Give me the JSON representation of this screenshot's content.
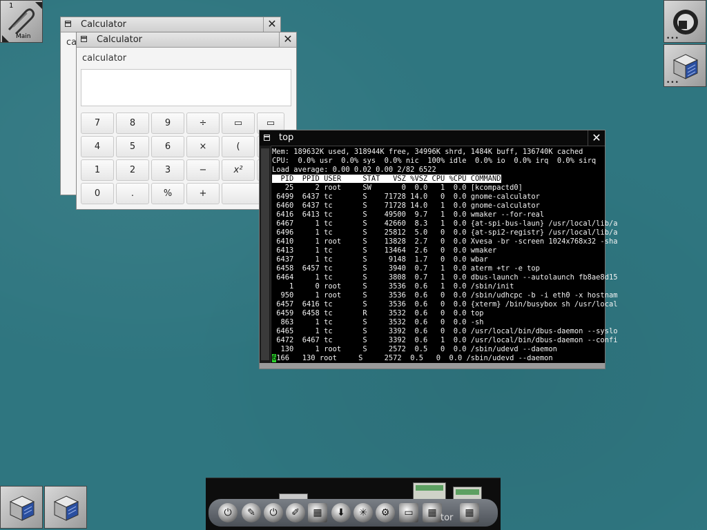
{
  "dock": {
    "clip_number": "1",
    "clip_label": "Main",
    "right_tiles": [
      "wmaker-logo-icon",
      "cube-icon"
    ],
    "bottom_tiles": [
      "cube-icon",
      "cube-icon"
    ]
  },
  "calc_back": {
    "title": "Calculator",
    "label_partial": "ca"
  },
  "calc_front": {
    "title": "Calculator",
    "label": "calculator",
    "buttons": [
      [
        "7",
        "8",
        "9",
        "÷",
        "▭",
        "▭"
      ],
      [
        "4",
        "5",
        "6",
        "×",
        "(",
        ""
      ],
      [
        "1",
        "2",
        "3",
        "−",
        "x²",
        ""
      ],
      [
        "0",
        ".",
        "%",
        "+",
        "",
        "="
      ]
    ]
  },
  "terminal": {
    "title": "top",
    "lines": [
      "Mem: 189632K used, 318944K free, 34996K shrd, 1484K buff, 136740K cached",
      "CPU:  0.0% usr  0.0% sys  0.0% nic  100% idle  0.0% io  0.0% irq  0.0% sirq",
      "Load average: 0.00 0.02 0.00 2/82 6522"
    ],
    "header": "  PID  PPID USER     STAT   VSZ %VSZ CPU %CPU COMMAND",
    "rows": [
      "   25     2 root     SW       0  0.0   1  0.0 [kcompactd0]",
      " 6499  6437 tc       S    71728 14.0   0  0.0 gnome-calculator",
      " 6460  6437 tc       S    71728 14.0   1  0.0 gnome-calculator",
      " 6416  6413 tc       S    49500  9.7   1  0.0 wmaker --for-real",
      " 6467     1 tc       S    42660  8.3   1  0.0 {at-spi-bus-laun} /usr/local/lib/a",
      " 6496     1 tc       S    25812  5.0   0  0.0 {at-spi2-registr} /usr/local/lib/a",
      " 6410     1 root     S    13828  2.7   0  0.0 Xvesa -br -screen 1024x768x32 -sha",
      " 6413     1 tc       S    13464  2.6   0  0.0 wmaker",
      " 6437     1 tc       S     9148  1.7   0  0.0 wbar",
      " 6458  6457 tc       S     3940  0.7   1  0.0 aterm +tr -e top",
      " 6464     1 tc       S     3808  0.7   1  0.0 dbus-launch --autolaunch fb8ae8d15",
      "    1     0 root     S     3536  0.6   1  0.0 /sbin/init",
      "  950     1 root     S     3536  0.6   0  0.0 /sbin/udhcpc -b -i eth0 -x hostnam",
      " 6457  6416 tc       S     3536  0.6   0  0.0 {xterm} /bin/busybox sh /usr/local",
      " 6459  6458 tc       R     3532  0.6   0  0.0 top",
      "  863     1 tc       S     3532  0.6   0  0.0 -sh",
      " 6465     1 tc       S     3392  0.6   0  0.0 /usr/local/bin/dbus-daemon --syslo",
      " 6472  6467 tc       S     3392  0.6   1  0.0 /usr/local/bin/dbus-daemon --confi",
      "  130     1 root     S     2572  0.5   0  0.0 /sbin/udevd --daemon"
    ],
    "last_row_cursor": "6",
    "last_row": "166   130 root     S     2572  0.5   0  0.0 /sbin/udevd --daemon"
  },
  "taskbar": {
    "hover_label": "tor",
    "icons": [
      "power-icon",
      "pen-icon",
      "power-icon",
      "brush-icon",
      "calculator-icon",
      "download-icon",
      "run-icon",
      "settings-icon",
      "network-icon",
      "terminal-icon",
      "calculator-icon",
      "calculator-icon"
    ]
  },
  "colors": {
    "desktop": "#2f7680",
    "terminal_bg": "#000000",
    "cursor": "#2bd62b"
  }
}
